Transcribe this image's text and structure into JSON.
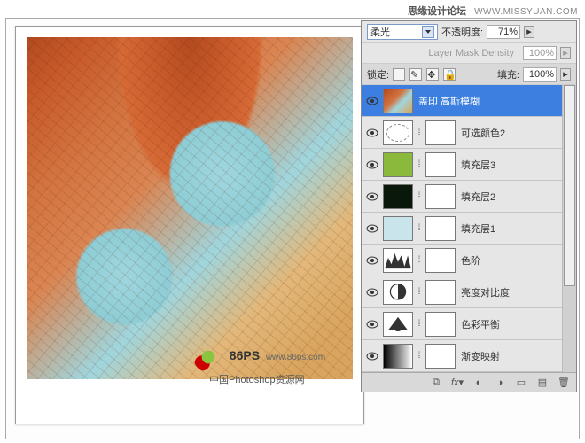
{
  "watermark": {
    "forum": "思缘设计论坛",
    "site_url": "WWW.MISSYUAN.COM",
    "logo_text": "86PS",
    "logo_url": "www.86ps.com",
    "logo_sub": "中国Photoshop资源网"
  },
  "panel": {
    "blend_mode": "柔光",
    "opacity_label": "不透明度:",
    "opacity_value": "71%",
    "mask_density_label": "Layer Mask Density",
    "mask_density_value": "100%",
    "lock_label": "锁定:",
    "fill_label": "填充:",
    "fill_value": "100%"
  },
  "layers": [
    {
      "name": "盖印 高斯模糊",
      "type": "image",
      "selected": true
    },
    {
      "name": "可选颜色2",
      "type": "selcol",
      "mask": true
    },
    {
      "name": "填充层3",
      "type": "fill-green",
      "mask": true
    },
    {
      "name": "填充层2",
      "type": "fill-dark",
      "mask": true
    },
    {
      "name": "填充层1",
      "type": "fill-lblue",
      "mask": true
    },
    {
      "name": "色阶",
      "type": "levels",
      "mask": true
    },
    {
      "name": "亮度对比度",
      "type": "bc",
      "mask": true
    },
    {
      "name": "色彩平衡",
      "type": "cb",
      "mask": true
    },
    {
      "name": "渐变映射",
      "type": "grad",
      "mask": true
    }
  ],
  "footer_icons": [
    "link",
    "fx",
    "mask",
    "adjust",
    "group",
    "new",
    "trash"
  ]
}
